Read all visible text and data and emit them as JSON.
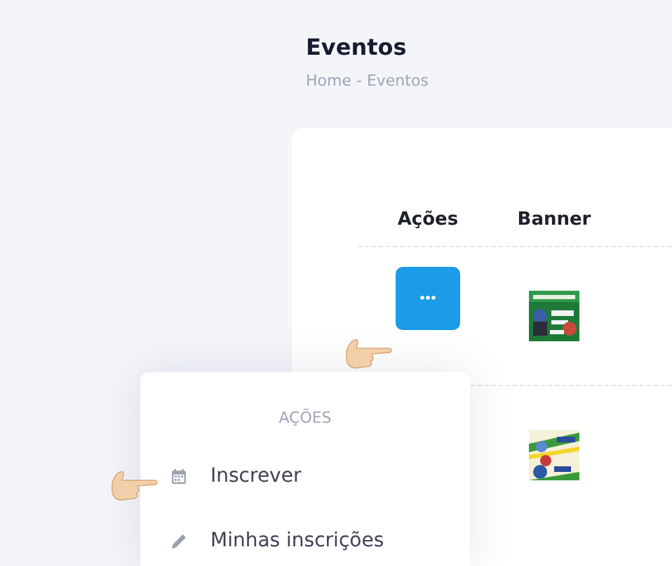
{
  "page": {
    "title": "Eventos",
    "breadcrumb": "Home - Eventos"
  },
  "table": {
    "columns": [
      "Ações",
      "Banner"
    ],
    "rows": [
      {
        "banner": {
          "kind": "picture"
        },
        "action": {
          "kind": "more"
        }
      },
      {
        "banner": {
          "kind": "picture"
        }
      }
    ]
  },
  "menu": {
    "header": "AÇÕES",
    "items": [
      {
        "label": "Inscrever",
        "kind": "calendar"
      },
      {
        "label": "Minhas inscrições",
        "kind": "pencil"
      }
    ]
  }
}
